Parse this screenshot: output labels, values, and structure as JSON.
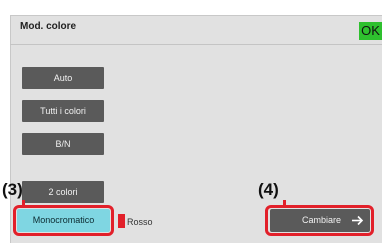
{
  "header": {
    "title": "Mod. colore",
    "ok_label": "OK"
  },
  "color_modes": {
    "auto": "Auto",
    "all_colors": "Tutti i colori",
    "bw": "B/N",
    "two_colors": "2 colori",
    "monochrome": "Monocromatico",
    "red": "Rosso"
  },
  "actions": {
    "change_label": "Cambiare"
  },
  "callouts": {
    "step3": "(3)",
    "step4": "(4)"
  },
  "colors": {
    "highlight": "#e2202a",
    "selected": "#7fd6e2",
    "button": "#5a5a5a",
    "ok": "#2ec02e",
    "swatch": "#e2202a"
  }
}
